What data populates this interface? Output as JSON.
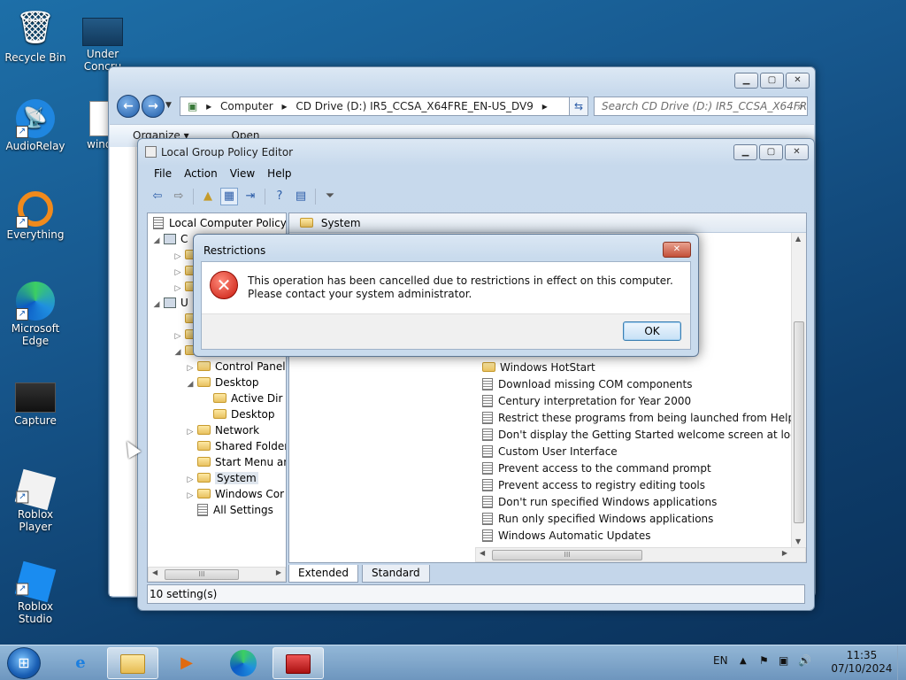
{
  "desktop": {
    "icons": [
      {
        "label": "Recycle Bin",
        "glyph": "🗑"
      },
      {
        "label": "Under Concru",
        "glyph": ""
      },
      {
        "label": "AudioRelay",
        "glyph": "📡"
      },
      {
        "label": "windo",
        "glyph": ""
      },
      {
        "label": "Everything",
        "glyph": "◯"
      },
      {
        "label": "Microsoft Edge",
        "glyph": "e"
      },
      {
        "label": "Capture",
        "glyph": ""
      },
      {
        "label": "Roblox Player",
        "glyph": "◆"
      },
      {
        "label": "Roblox Studio",
        "glyph": "◆"
      }
    ]
  },
  "explorer": {
    "address_parts": [
      "Computer",
      "CD Drive (D:) IR5_CCSA_X64FRE_EN-US_DV9"
    ],
    "search_placeholder": "Search CD Drive (D:) IR5_CCSA_X64FR...",
    "organize_label": "Organize ▾",
    "open_label": "Open"
  },
  "gpedit": {
    "title": "Local Group Policy Editor",
    "menu": [
      "File",
      "Action",
      "View",
      "Help"
    ],
    "tree": {
      "root": "Local Computer Policy",
      "c_label": "C",
      "u_label": "U",
      "items": [
        {
          "label": "Control Panel",
          "indent": 3,
          "expander": "▷"
        },
        {
          "label": "Desktop",
          "indent": 3,
          "expander": "◢"
        },
        {
          "label": "Active Dir",
          "indent": 4,
          "expander": ""
        },
        {
          "label": "Desktop",
          "indent": 4,
          "expander": ""
        },
        {
          "label": "Network",
          "indent": 3,
          "expander": "▷"
        },
        {
          "label": "Shared Folder",
          "indent": 3,
          "expander": ""
        },
        {
          "label": "Start Menu an",
          "indent": 3,
          "expander": ""
        },
        {
          "label": "System",
          "indent": 3,
          "expander": "▷",
          "selected": true
        },
        {
          "label": "Windows Cor",
          "indent": 3,
          "expander": "▷"
        },
        {
          "label": "All Settings",
          "indent": 3,
          "expander": ""
        }
      ]
    },
    "list_header": "System",
    "list": [
      {
        "label": "Windows HotStart",
        "kind": "folder"
      },
      {
        "label": "Download missing COM components",
        "kind": "policy"
      },
      {
        "label": "Century interpretation for Year 2000",
        "kind": "policy"
      },
      {
        "label": "Restrict these programs from being launched from Help",
        "kind": "policy"
      },
      {
        "label": "Don't display the Getting Started welcome screen at logon",
        "kind": "policy"
      },
      {
        "label": "Custom User Interface",
        "kind": "policy"
      },
      {
        "label": "Prevent access to the command prompt",
        "kind": "policy"
      },
      {
        "label": "Prevent access to registry editing tools",
        "kind": "policy"
      },
      {
        "label": "Don't run specified Windows applications",
        "kind": "policy"
      },
      {
        "label": "Run only specified Windows applications",
        "kind": "policy"
      },
      {
        "label": "Windows Automatic Updates",
        "kind": "policy"
      }
    ],
    "tabs": [
      "Extended",
      "Standard"
    ],
    "status": "10 setting(s)"
  },
  "dialog": {
    "title": "Restrictions",
    "message": "This operation has been cancelled due to restrictions in effect on this computer. Please contact your system administrator.",
    "ok_label": "OK"
  },
  "taskbar": {
    "language": "EN",
    "time": "11:35",
    "date": "07/10/2024"
  }
}
